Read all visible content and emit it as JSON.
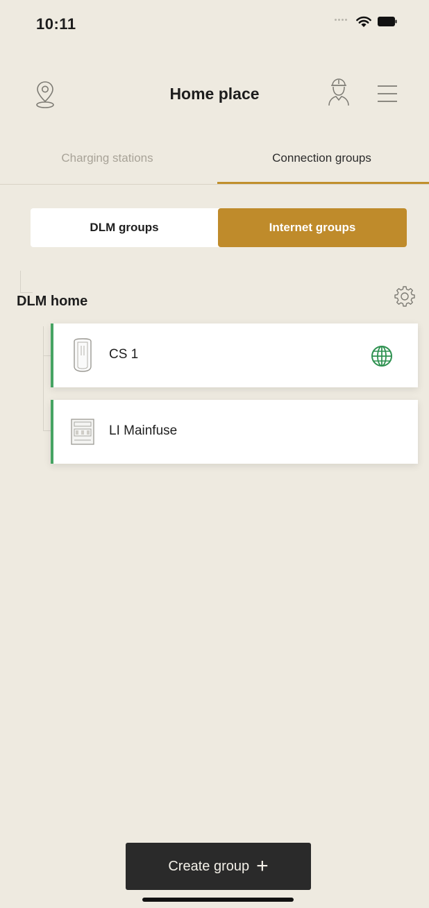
{
  "status_bar": {
    "time": "10:11"
  },
  "header": {
    "title": "Home place"
  },
  "tabs": [
    {
      "label": "Charging stations",
      "active": false
    },
    {
      "label": "Connection groups",
      "active": true
    }
  ],
  "segments": [
    {
      "label": "DLM groups",
      "selected": false
    },
    {
      "label": "Internet groups",
      "selected": true
    }
  ],
  "group": {
    "name": "DLM home",
    "devices": [
      {
        "name": "CS 1",
        "icon": "charging-station-icon",
        "status_icon": "globe-icon"
      },
      {
        "name": "LI Mainfuse",
        "icon": "fuse-box-icon"
      }
    ]
  },
  "create_button": {
    "label": "Create group",
    "icon": "plus-icon"
  },
  "colors": {
    "accent": "#bf8b2b",
    "background": "#eeeae0",
    "online_green": "#46a463",
    "dark_button": "#2a2a2a"
  }
}
